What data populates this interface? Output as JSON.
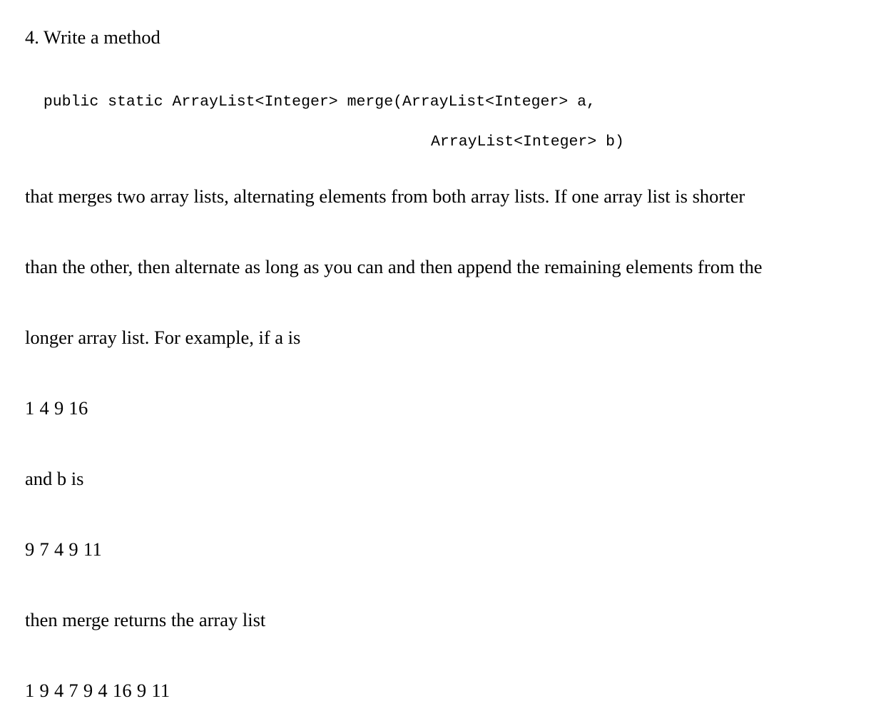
{
  "heading": "4. Write a method",
  "code": {
    "line1": "public static ArrayList<Integer> merge(ArrayList<Integer> a,",
    "line2": "ArrayList<Integer> b)"
  },
  "paragraph": {
    "lines": [
      "that merges two array lists, alternating elements from both array lists. If one array list is shorter",
      "than the other, then alternate as long as you can and then append the remaining elements from the",
      "longer array list. For example, if a is"
    ]
  },
  "example": {
    "a_values": "1 4 9 16",
    "b_intro": "and b is",
    "b_values": "9 7 4 9 11",
    "result_intro": "then merge returns the array list",
    "result_values": "1 9 4 7 9 4 16 9 11"
  }
}
